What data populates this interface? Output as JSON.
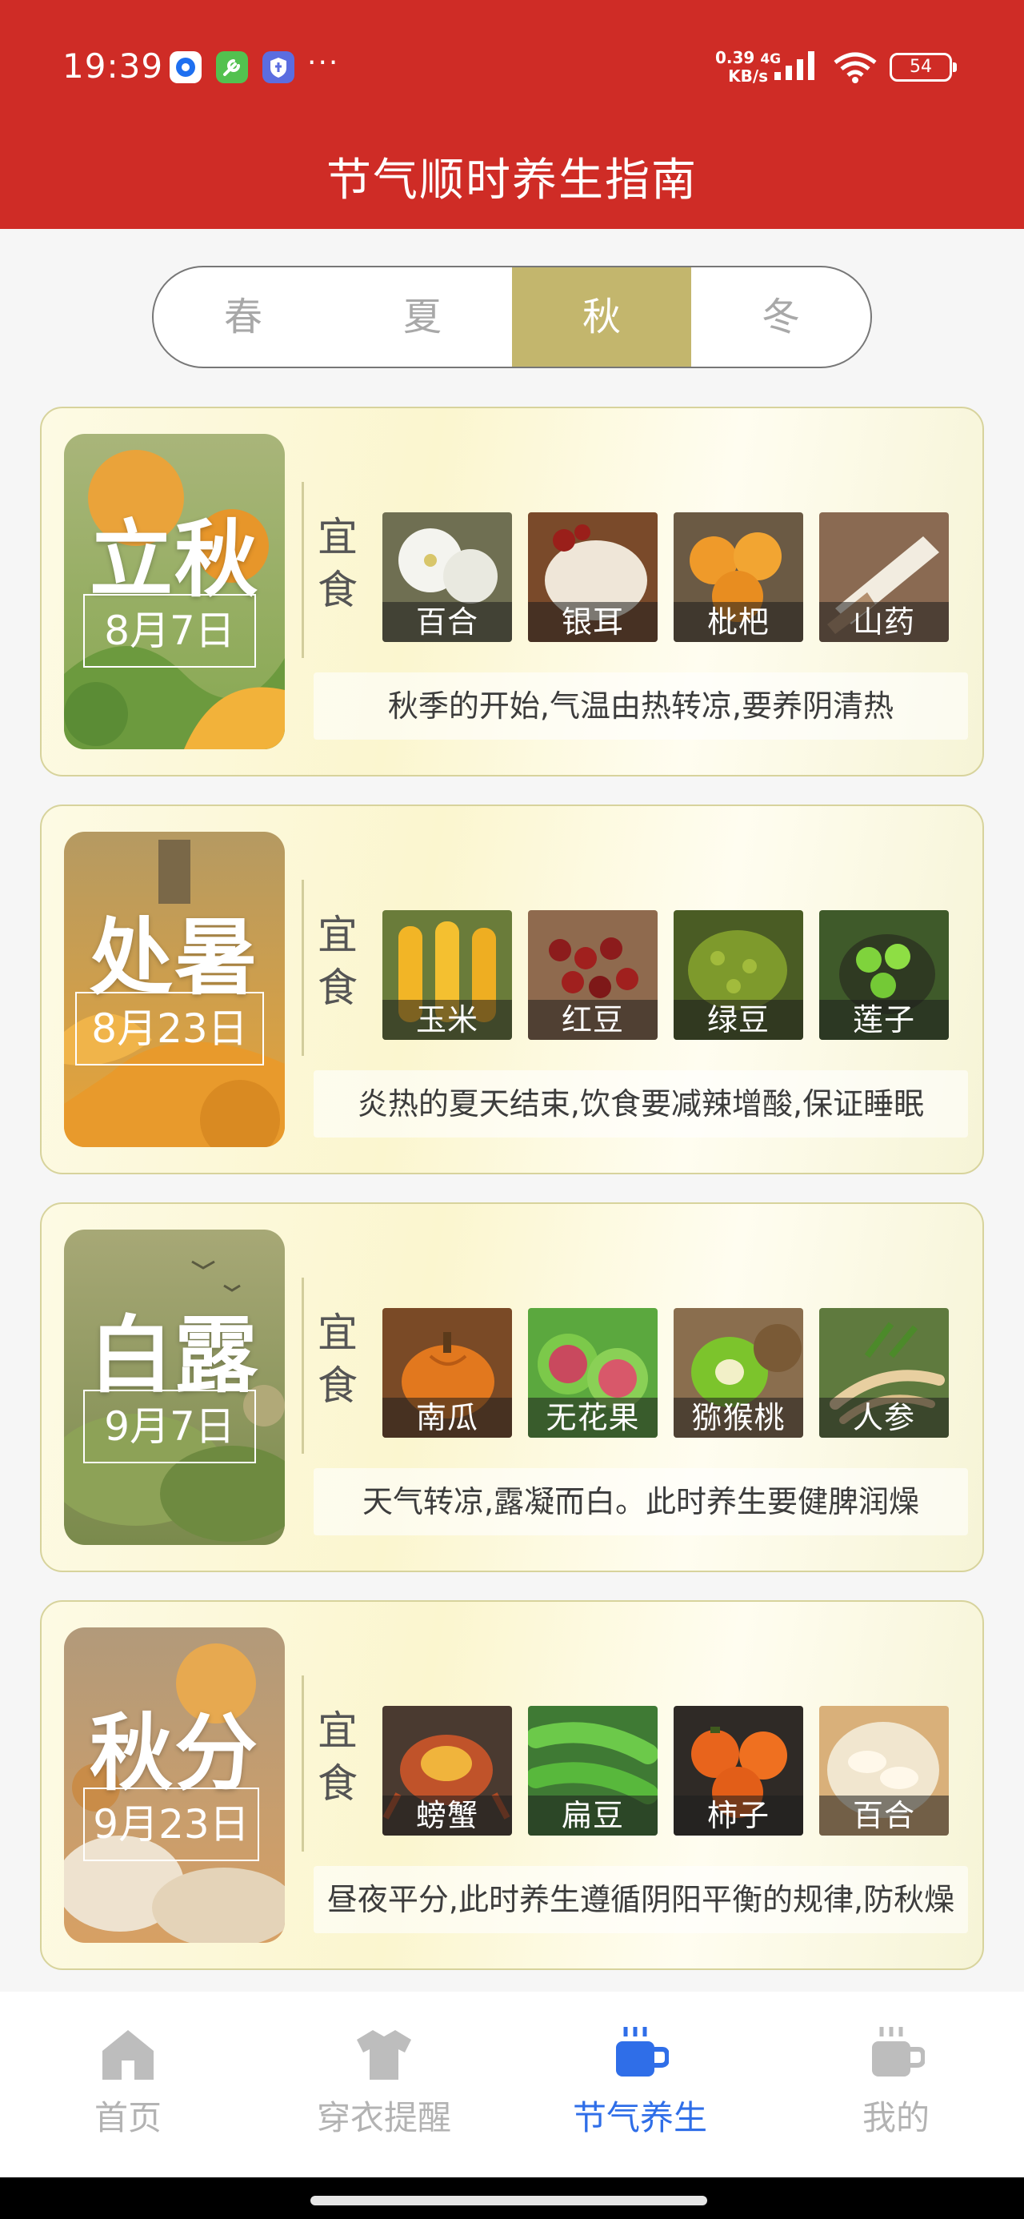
{
  "status_bar": {
    "time": "19:39",
    "app_icons": [
      "chat-app-icon",
      "tool-app-icon",
      "shield-app-icon"
    ],
    "more_dots": "···",
    "net_speed_value": "0.39",
    "net_speed_unit": "KB/s",
    "network_type": "4G",
    "battery": "54"
  },
  "header": {
    "title": "节气顺时养生指南"
  },
  "season_tabs": {
    "items": [
      {
        "label": "春",
        "active": false
      },
      {
        "label": "夏",
        "active": false
      },
      {
        "label": "秋",
        "active": true
      },
      {
        "label": "冬",
        "active": false
      }
    ]
  },
  "food_section_label": "宜食",
  "terms": [
    {
      "name": "立秋",
      "date": "8月7日",
      "foods": [
        "百合",
        "银耳",
        "枇杷",
        "山药"
      ],
      "description": "秋季的开始,气温由热转凉,要养阴清热"
    },
    {
      "name": "处暑",
      "date": "8月23日",
      "foods": [
        "玉米",
        "红豆",
        "绿豆",
        "莲子"
      ],
      "description": "炎热的夏天结束,饮食要减辣增酸,保证睡眠"
    },
    {
      "name": "白露",
      "date": "9月7日",
      "foods": [
        "南瓜",
        "无花果",
        "猕猴桃",
        "人参"
      ],
      "description": "天气转凉,露凝而白。此时养生要健脾润燥"
    },
    {
      "name": "秋分",
      "date": "9月23日",
      "foods": [
        "螃蟹",
        "扁豆",
        "柿子",
        "百合"
      ],
      "description": "昼夜平分,此时养生遵循阴阳平衡的规律,防秋燥"
    }
  ],
  "bottom_nav": {
    "items": [
      {
        "label": "首页",
        "icon": "home-icon",
        "active": false
      },
      {
        "label": "穿衣提醒",
        "icon": "shirt-icon",
        "active": false
      },
      {
        "label": "节气养生",
        "icon": "cup-icon",
        "active": true
      },
      {
        "label": "我的",
        "icon": "cup-icon",
        "active": false
      }
    ]
  },
  "colors": {
    "header_red": "#cf2c26",
    "season_active": "#c3b66d",
    "nav_active": "#2f6ee8",
    "nav_inactive": "#b3b3b3"
  }
}
